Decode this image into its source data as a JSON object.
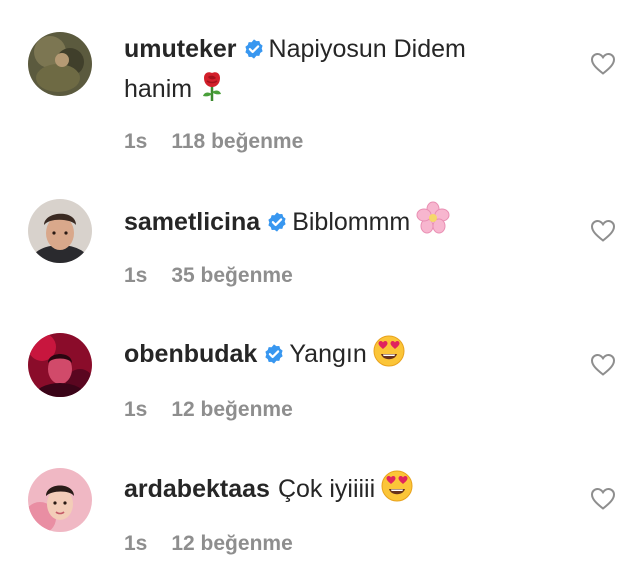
{
  "comments": [
    {
      "username": "umuteker",
      "verified": true,
      "text_line1": "Napiyosun Didem",
      "text_line2": "hanim",
      "emoji": "rose",
      "time": "1s",
      "likes": "118 beğenme"
    },
    {
      "username": "sametlicina",
      "verified": true,
      "text": "Biblommm",
      "emoji": "cherry-blossom",
      "time": "1s",
      "likes": "35 beğenme"
    },
    {
      "username": "obenbudak",
      "verified": true,
      "text": "Yangın",
      "emoji": "heart-eyes",
      "time": "1s",
      "likes": "12 beğenme"
    },
    {
      "username": "ardabektaas",
      "verified": false,
      "text": "Çok iyiiiii",
      "emoji": "heart-eyes",
      "time": "1s",
      "likes": "12 beğenme"
    }
  ],
  "colors": {
    "verified_badge": "#3897f0",
    "meta_text": "#8e8e8e",
    "primary_text": "#262626",
    "heart_outline": "#8e8e8e"
  }
}
